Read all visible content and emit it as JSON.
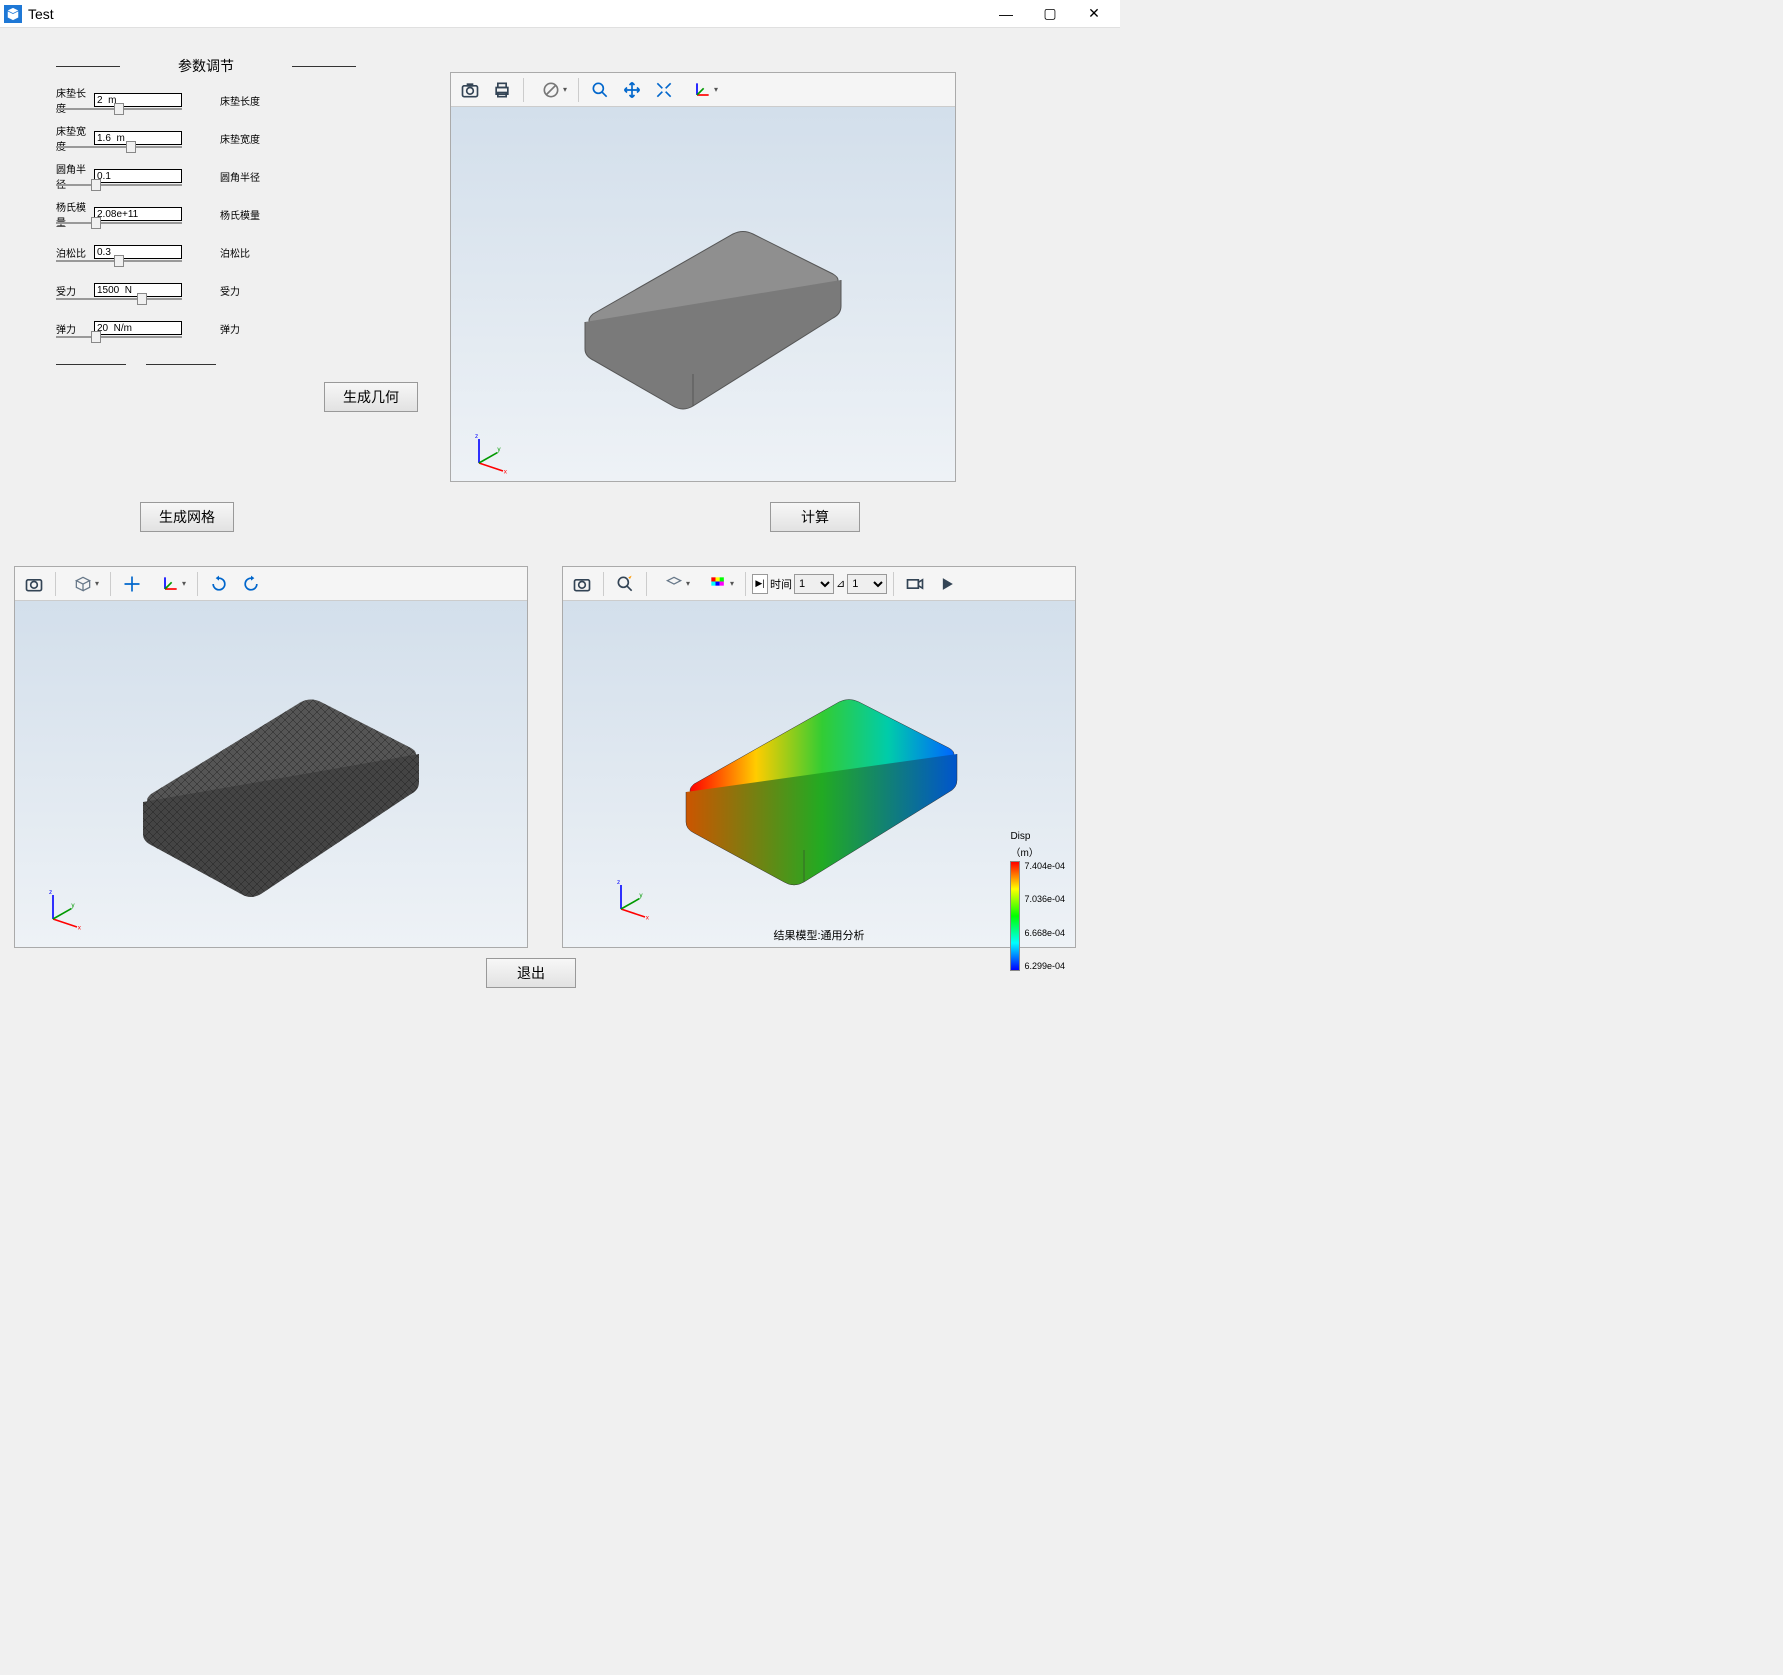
{
  "window": {
    "title": "Test"
  },
  "param_panel": {
    "heading": "参数调节",
    "rows": [
      {
        "label": "床垫长度",
        "value": "2  m",
        "desc": "床垫长度"
      },
      {
        "label": "床垫宽度",
        "value": "1.6  m",
        "desc": "床垫宽度"
      },
      {
        "label": "圆角半径",
        "value": "0.1",
        "desc": "圆角半径"
      },
      {
        "label": "杨氏模量",
        "value": "2.08e+11",
        "desc": "杨氏模量"
      },
      {
        "label": "泊松比",
        "value": "0.3",
        "desc": "泊松比"
      },
      {
        "label": "受力",
        "value": "1500  N",
        "desc": "受力"
      },
      {
        "label": "弹力",
        "value": "20  N/m",
        "desc": "弹力"
      }
    ]
  },
  "buttons": {
    "generate_geometry": "生成几何",
    "generate_mesh": "生成网格",
    "compute": "计算",
    "exit": "退出"
  },
  "vp3": {
    "time_label": "时间",
    "time_select1": "1",
    "time_select2": "1",
    "result_caption": "结果模型:通用分析",
    "legend": {
      "title": "Disp",
      "unit": "（m）",
      "ticks": [
        "7.404e-04",
        "7.036e-04",
        "6.668e-04",
        "6.299e-04"
      ]
    }
  },
  "axes": {
    "x": "x",
    "y": "y",
    "z": "z"
  }
}
